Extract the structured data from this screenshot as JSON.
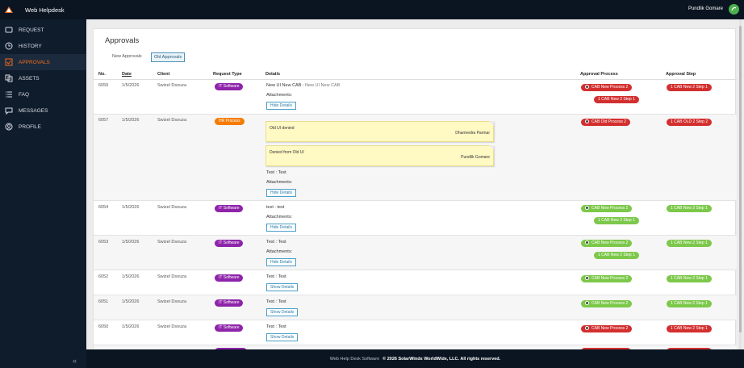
{
  "app": {
    "title": "Web Helpdesk",
    "user": "Pundlik Gomare"
  },
  "sidebar": {
    "items": [
      {
        "label": "REQUEST",
        "icon": "request-icon"
      },
      {
        "label": "HISTORY",
        "icon": "clock-icon"
      },
      {
        "label": "APPROVALS",
        "icon": "checkbox-icon",
        "active": true
      },
      {
        "label": "ASSETS",
        "icon": "assets-icon"
      },
      {
        "label": "FAQ",
        "icon": "list-icon"
      },
      {
        "label": "MESSAGES",
        "icon": "chat-icon"
      },
      {
        "label": "PROFILE",
        "icon": "profile-icon"
      }
    ],
    "collapse_label": "«"
  },
  "page": {
    "title": "Approvals",
    "tabs": [
      {
        "label": "New Approvals"
      },
      {
        "label": "Old Approvals",
        "selected": true
      }
    ]
  },
  "table": {
    "headers": {
      "no": "No.",
      "date": "Date",
      "client": "Client",
      "request_type": "Request Type",
      "details": "Details",
      "approval_process": "Approval Process",
      "approval_step": "Approval Step"
    },
    "attachments_label": "Attachments:",
    "rows": [
      {
        "no": "6059",
        "date": "1/5/2026",
        "client": "Swizel Dsouza",
        "type": "IT Software",
        "details_title": "New UI New CAB",
        "details_sep": " : ",
        "details_desc": "New UI New CAB",
        "button": "Hide Details",
        "process": "CAB New Process 2",
        "process_sub": "1 CAB New 2 Step 1",
        "step": "1 CAB New 2 Step 1"
      },
      {
        "no": "6057",
        "date": "1/5/2026",
        "client": "Swizel Dsouza",
        "type": "HR Process",
        "note1_text": "Old UI denied",
        "note1_author": "Dharmedra Parmar",
        "note2_text": "Denied from Old UI",
        "note2_author": "Pundlik Gomare",
        "details": "Test : Test",
        "button": "Hide Details",
        "process": "CAB Old Process 2",
        "step": "1 CAB OLD 2 Step 2"
      },
      {
        "no": "6054",
        "date": "1/5/2026",
        "client": "Swizel Dsouza",
        "type": "IT Software",
        "details": "test : test",
        "button": "Hide Details",
        "process": "CAB New Process 2",
        "process_sub": "1 CAB New 2 Step 1",
        "step": "1 CAB New 2 Step 1"
      },
      {
        "no": "6053",
        "date": "1/5/2026",
        "client": "Swizel Dsouza",
        "type": "IT Software",
        "details": "Test : Test",
        "button": "Hide Details",
        "process": "CAB New Process 2",
        "process_sub": "1 CAB New 2 Step 1",
        "step": "1 CAB New 2 Step 1"
      },
      {
        "no": "6052",
        "date": "1/5/2026",
        "client": "Swizel Dsouza",
        "type": "IT Software",
        "details": "Test : Test",
        "button": "Show Details",
        "process": "CAB New Process 2",
        "step": "1 CAB New 2 Step 1"
      },
      {
        "no": "6051",
        "date": "1/5/2026",
        "client": "Swizel Dsouza",
        "type": "IT Software",
        "details": "Test : Test",
        "button": "Show Details",
        "process": "CAB New Process 2",
        "step": "1 CAB New 2 Step 1"
      },
      {
        "no": "6050",
        "date": "1/5/2026",
        "client": "Swizel Dsouza",
        "type": "IT Software",
        "details": "Test : Test",
        "button": "Show Details",
        "process": "CAB New Process 2",
        "step": "1 CAB New 2 Step 1"
      }
    ]
  },
  "footer": {
    "text": "Web Help Desk Software",
    "copyright": "© 2026 SolarWinds WorldWide, LLC. All rights reserved."
  },
  "colors": {
    "accent": "#f26d21",
    "purple": "#8e24aa",
    "orange": "#f57c00",
    "red": "#d32f2f",
    "green": "#7cc84a"
  }
}
